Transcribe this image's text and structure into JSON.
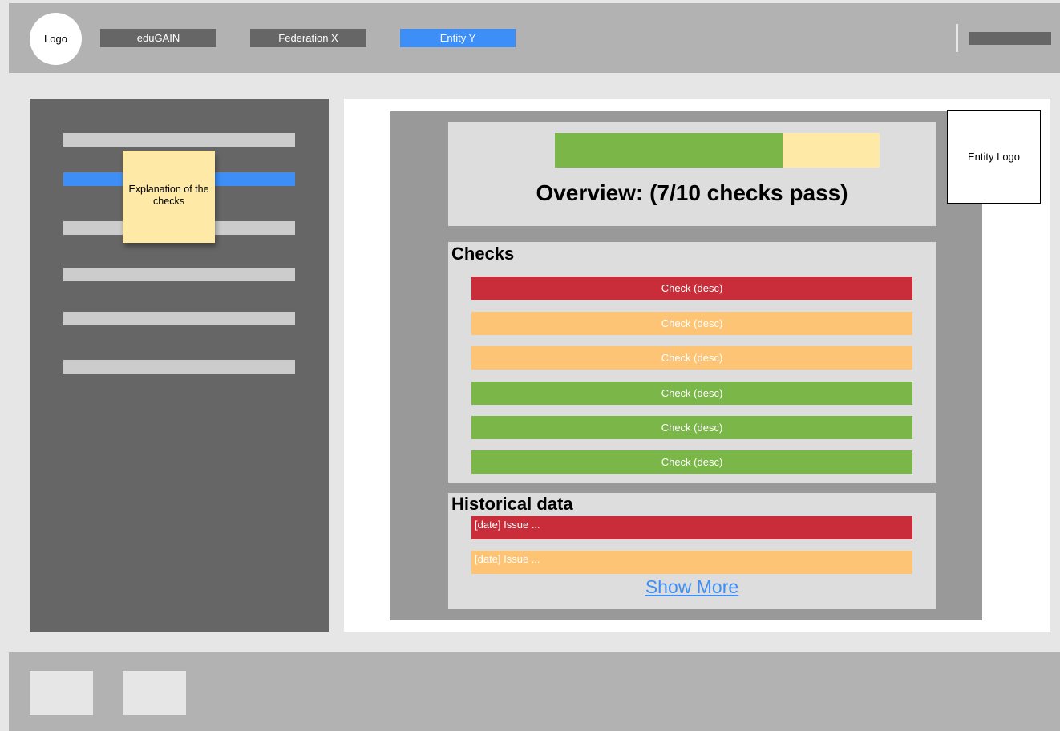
{
  "header": {
    "logo": "Logo",
    "tabs": [
      {
        "label": "eduGAIN",
        "active": false
      },
      {
        "label": "Federation X",
        "active": false
      },
      {
        "label": "Entity Y",
        "active": true
      }
    ]
  },
  "sidebar": {
    "item_count": 6,
    "active_index": 1,
    "note": "Explanation of the checks"
  },
  "main": {
    "entity_logo": "Entity Logo",
    "overview": {
      "title": "Overview: (7/10 checks pass)",
      "progress_fraction": 0.7
    },
    "checks": {
      "title": "Checks",
      "items": [
        {
          "label": "Check (desc)",
          "status": "red"
        },
        {
          "label": "Check (desc)",
          "status": "orange"
        },
        {
          "label": "Check (desc)",
          "status": "orange"
        },
        {
          "label": "Check (desc)",
          "status": "green"
        },
        {
          "label": "Check (desc)",
          "status": "green"
        },
        {
          "label": "Check (desc)",
          "status": "green"
        }
      ]
    },
    "history": {
      "title": "Historical data",
      "items": [
        {
          "label": "[date] Issue ...",
          "status": "red"
        },
        {
          "label": "[date] Issue ...",
          "status": "orange"
        }
      ],
      "show_more": "Show More"
    }
  },
  "colors": {
    "accent": "#3d8ef7",
    "red": "#c92d39",
    "orange": "#fcc474",
    "green": "#7ab648",
    "note": "#fee9a6"
  }
}
